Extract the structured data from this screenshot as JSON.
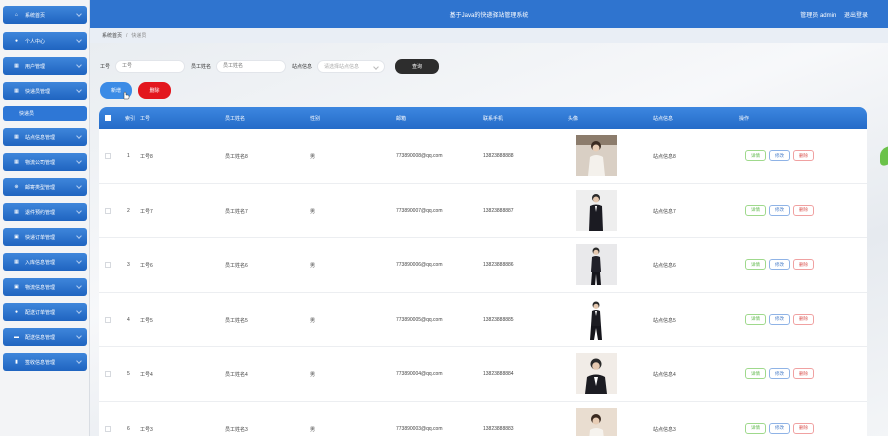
{
  "header": {
    "title": "基于Java的快递驿站管理系统",
    "role": "管理员 admin",
    "logout": "退出登录"
  },
  "sidebar": {
    "items": [
      {
        "label": "系统首页",
        "icon": "home-icon"
      },
      {
        "label": "个人中心",
        "icon": "user-icon"
      },
      {
        "label": "用户管理",
        "icon": "grid-icon"
      },
      {
        "label": "快递员管理",
        "icon": "grid-icon"
      },
      {
        "label": "快递员",
        "icon": ""
      },
      {
        "label": "站点信息管理",
        "icon": "grid-icon"
      },
      {
        "label": "物流公司管理",
        "icon": "grid-icon"
      },
      {
        "label": "邮寄类型管理",
        "icon": "tag-icon"
      },
      {
        "label": "退件预约管理",
        "icon": "grid-icon"
      },
      {
        "label": "快递订单管理",
        "icon": "box-icon"
      },
      {
        "label": "入库信息管理",
        "icon": "grid-icon"
      },
      {
        "label": "物流信息管理",
        "icon": "box-icon"
      },
      {
        "label": "配送订单管理",
        "icon": "user-icon"
      },
      {
        "label": "配送信息管理",
        "icon": "card-icon"
      },
      {
        "label": "签收信息管理",
        "icon": "doc-icon"
      }
    ]
  },
  "breadcrumb": {
    "home": "系统首页",
    "sep": "/",
    "current": "快递员"
  },
  "search": {
    "id_label": "工号",
    "id_placeholder": "工号",
    "name_label": "员工姓名",
    "name_placeholder": "员工姓名",
    "site_label": "站点信息",
    "site_placeholder": "请选择站点信息",
    "query_button": "查询"
  },
  "actions": {
    "add": "新增",
    "delete": "删除"
  },
  "table": {
    "headers": [
      "索引",
      "工号",
      "员工姓名",
      "性别",
      "邮箱",
      "联系手机",
      "头像",
      "站点信息",
      "操作"
    ],
    "rows": [
      {
        "index": "1",
        "id": "工号8",
        "name": "员工姓名8",
        "gender": "男",
        "email": "773890008@qq.com",
        "phone": "13823888888",
        "site": "站点信息8"
      },
      {
        "index": "2",
        "id": "工号7",
        "name": "员工姓名7",
        "gender": "男",
        "email": "773890007@qq.com",
        "phone": "13823888887",
        "site": "站点信息7"
      },
      {
        "index": "3",
        "id": "工号6",
        "name": "员工姓名6",
        "gender": "男",
        "email": "773890006@qq.com",
        "phone": "13823888886",
        "site": "站点信息6"
      },
      {
        "index": "4",
        "id": "工号5",
        "name": "员工姓名5",
        "gender": "男",
        "email": "773890005@qq.com",
        "phone": "13823888885",
        "site": "站点信息5"
      },
      {
        "index": "5",
        "id": "工号4",
        "name": "员工姓名4",
        "gender": "男",
        "email": "773890004@qq.com",
        "phone": "13823888884",
        "site": "站点信息4"
      },
      {
        "index": "6",
        "id": "工号3",
        "name": "员工姓名3",
        "gender": "男",
        "email": "773890003@qq.com",
        "phone": "13823888883",
        "site": "站点信息3"
      }
    ],
    "ops": {
      "detail": "详情",
      "edit": "修改",
      "remove": "删除"
    }
  },
  "colors": {
    "primary": "#2f74cf",
    "danger": "#e3161d",
    "query": "#2d2d2d"
  }
}
